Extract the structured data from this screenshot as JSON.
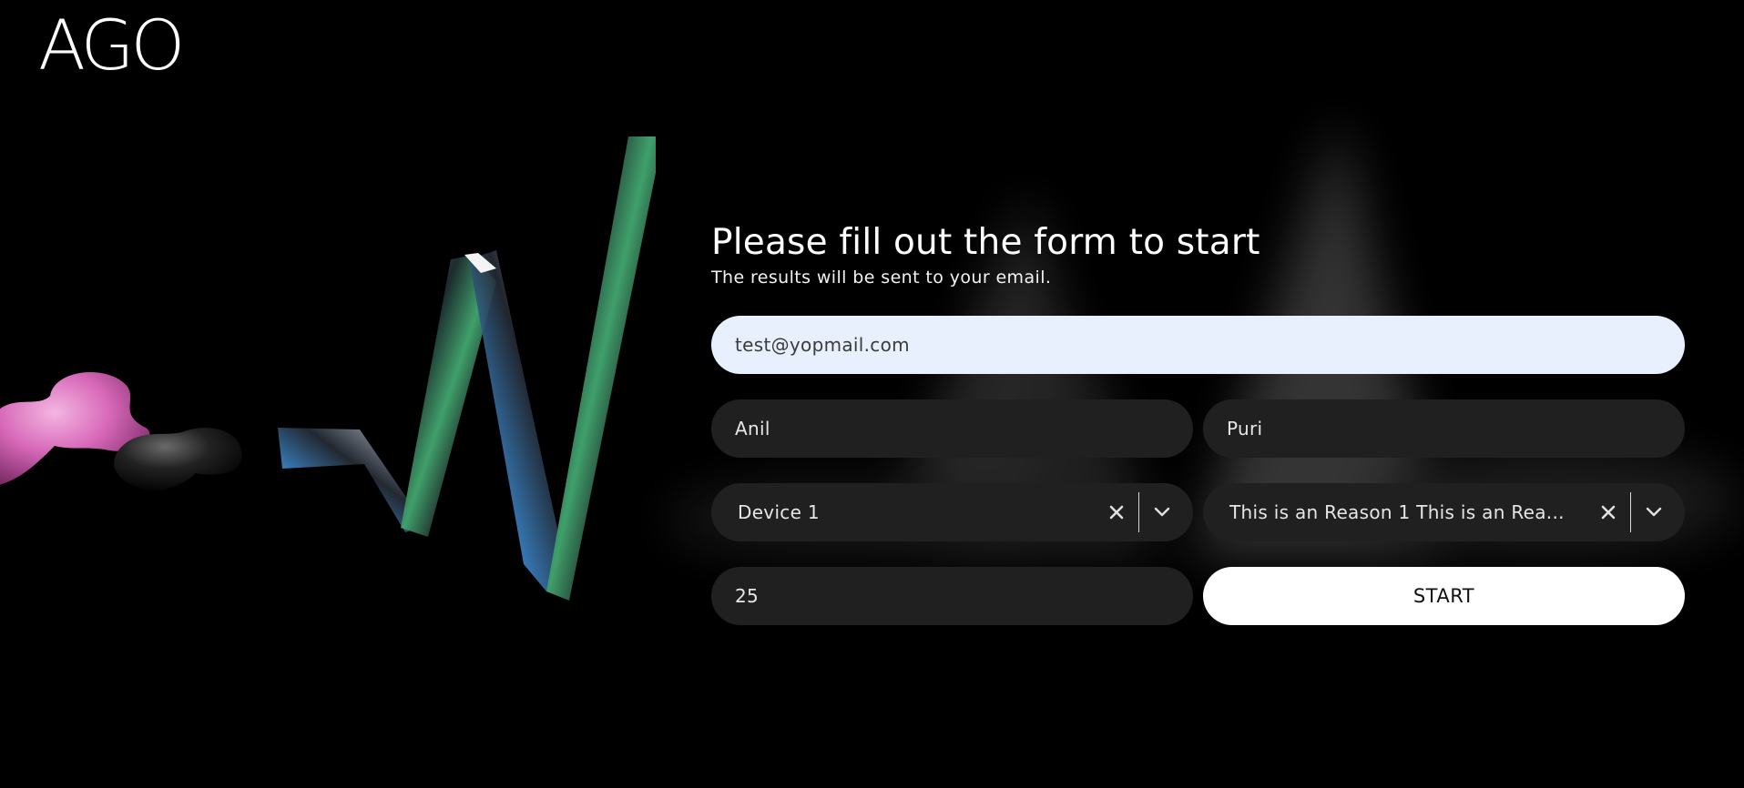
{
  "brand": {
    "logo_text": "AGO"
  },
  "form": {
    "title": "Please fill out the form to start",
    "subtitle": "The results will be sent to your email.",
    "email": {
      "value": "test@yopmail.com"
    },
    "first_name": {
      "value": "Anil"
    },
    "last_name": {
      "value": "Puri"
    },
    "device_select": {
      "selected": "Device 1"
    },
    "reason_select": {
      "selected": "This is an Reason 1 This is an Rea..."
    },
    "age": {
      "value": "25"
    },
    "start_label": "START"
  },
  "icons": {
    "clear": "close-icon",
    "dropdown": "chevron-down-icon"
  },
  "colors": {
    "background": "#000000",
    "field_bg": "#202020",
    "email_bg": "#e8f0fe",
    "button_bg": "#ffffff",
    "accent_pink": "#e879c6"
  }
}
